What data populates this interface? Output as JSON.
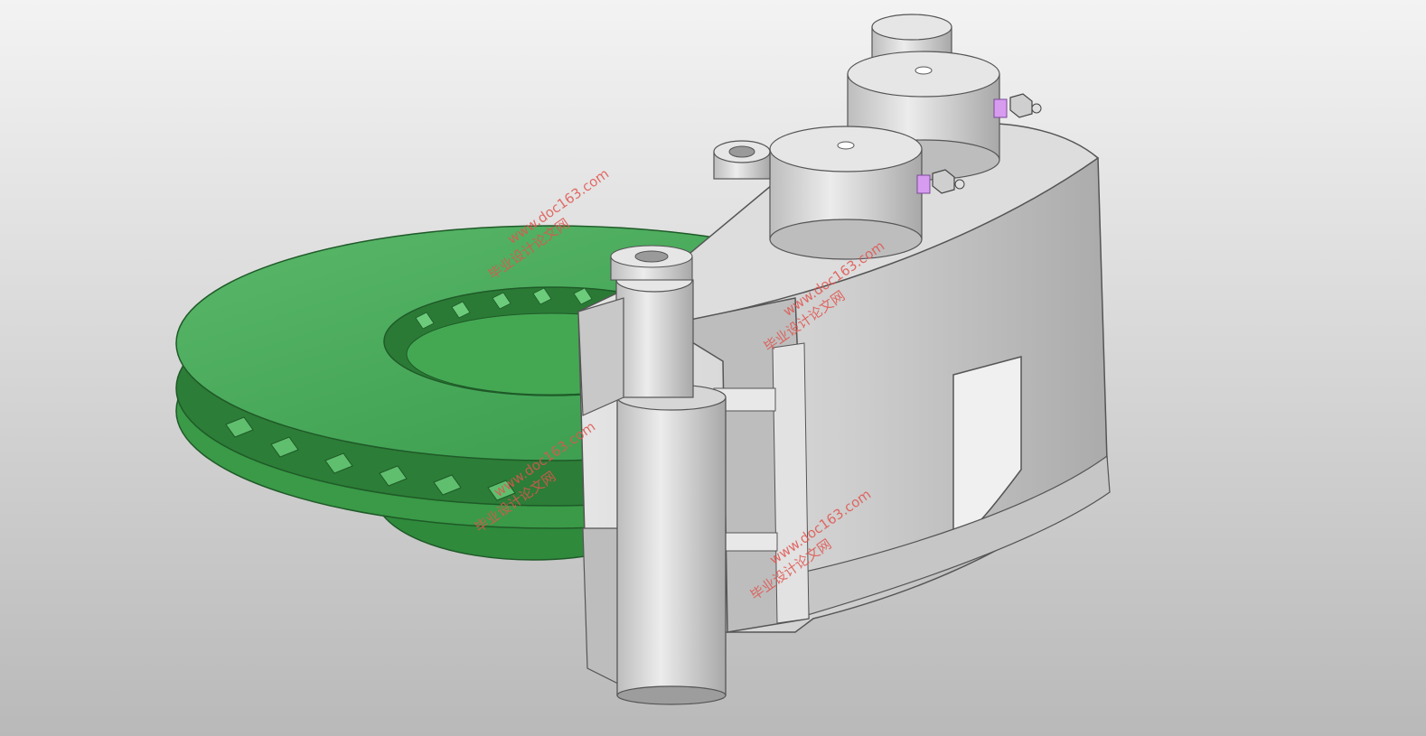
{
  "colors": {
    "rotor": "#3fa34d",
    "rotor_dark": "#2c7d37",
    "caliper": "#d4d4d4",
    "caliper_dark": "#a7a7a7",
    "background_top": "#f3f3f3",
    "background_bottom": "#b9b9b9",
    "watermark": "#e0554f",
    "bolt_accent": "#d79cf0"
  },
  "watermarks": [
    {
      "site": "www.doc163.com",
      "brand": "毕业设计论文网"
    },
    {
      "site": "www.doc163.com",
      "brand": "毕业设计论文网"
    },
    {
      "site": "www.doc163.com",
      "brand": "毕业设计论文网"
    },
    {
      "site": "www.doc163.com",
      "brand": "毕业设计论文网"
    }
  ]
}
